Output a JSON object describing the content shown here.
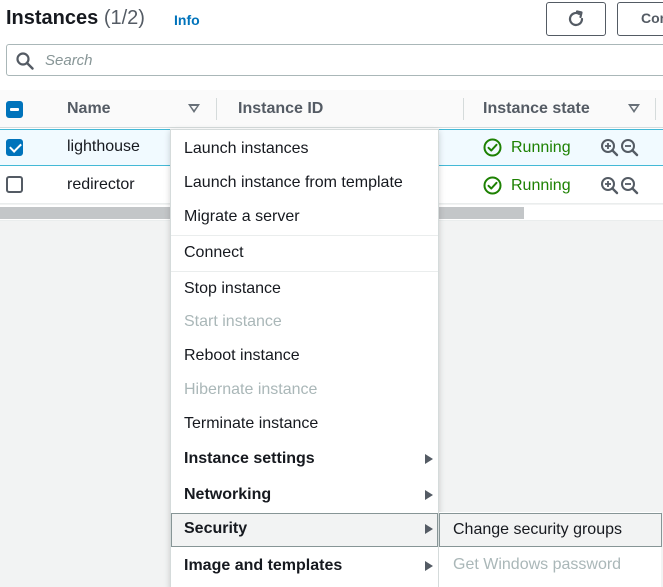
{
  "header": {
    "title": "Instances",
    "count": "(1/2)",
    "info_label": "Info",
    "refresh_icon": "refresh-icon",
    "connect_label": "Connect"
  },
  "search": {
    "placeholder": "Search",
    "value": "",
    "icon": "search-icon"
  },
  "table": {
    "columns": [
      {
        "label": "Name",
        "sortable": true
      },
      {
        "label": "Instance ID",
        "sortable": false
      },
      {
        "label": "Instance state",
        "sortable": true
      }
    ],
    "select_all_state": "indeterminate",
    "rows": [
      {
        "selected": true,
        "name": "lighthouse",
        "state": "Running"
      },
      {
        "selected": false,
        "name": "redirector",
        "state": "Running"
      }
    ],
    "scroll_thumb_fraction": 0.79
  },
  "actions_menu": {
    "items": [
      {
        "label": "Launch instances",
        "enabled": true,
        "submenu": false
      },
      {
        "label": "Launch instance from template",
        "enabled": true,
        "submenu": false
      },
      {
        "label": "Migrate a server",
        "enabled": true,
        "submenu": false
      },
      {
        "label": "Connect",
        "enabled": true,
        "submenu": false
      },
      {
        "label": "Stop instance",
        "enabled": true,
        "submenu": false
      },
      {
        "label": "Start instance",
        "enabled": false,
        "submenu": false
      },
      {
        "label": "Reboot instance",
        "enabled": true,
        "submenu": false
      },
      {
        "label": "Hibernate instance",
        "enabled": false,
        "submenu": false
      },
      {
        "label": "Terminate instance",
        "enabled": true,
        "submenu": false
      },
      {
        "label": "Instance settings",
        "enabled": true,
        "submenu": true
      },
      {
        "label": "Networking",
        "enabled": true,
        "submenu": true
      },
      {
        "label": "Security",
        "enabled": true,
        "submenu": true,
        "active": true
      },
      {
        "label": "Image and templates",
        "enabled": true,
        "submenu": true
      }
    ]
  },
  "security_submenu": {
    "items": [
      {
        "label": "Change security groups",
        "enabled": true,
        "active": true
      },
      {
        "label": "Get Windows password",
        "enabled": false
      }
    ]
  },
  "colors": {
    "accent": "#0073bb",
    "running": "#1d8102",
    "disabled_text": "#aab7b8",
    "selected_row_bg": "#f1faff"
  }
}
